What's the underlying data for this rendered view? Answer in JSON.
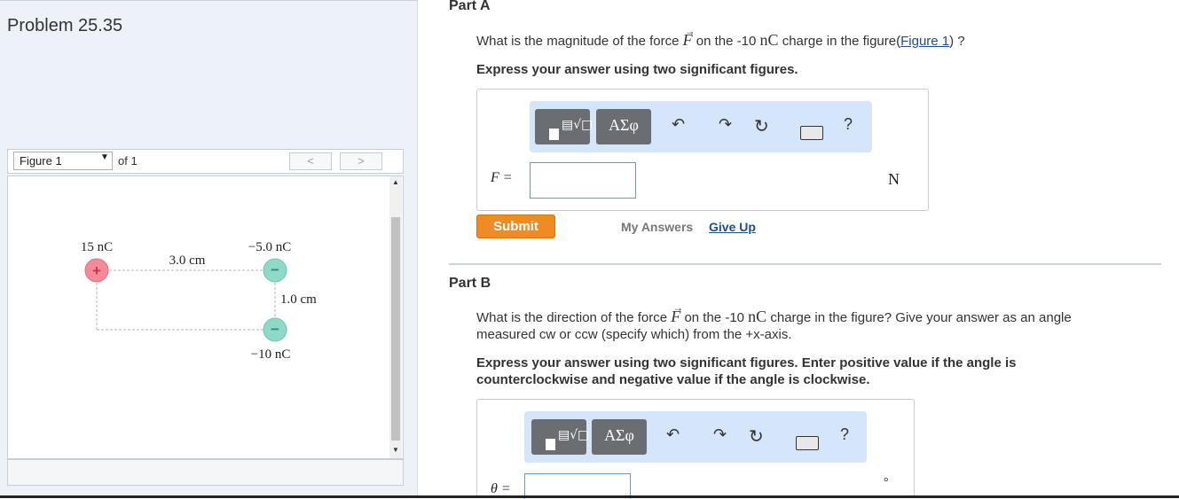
{
  "left": {
    "problem_title": "Problem 25.35",
    "figure_select": "Figure 1",
    "of_label": "of 1",
    "prev": "<",
    "next": ">"
  },
  "figure": {
    "q1": "15 nC",
    "q2": "−5.0 nC",
    "q3": "−10 nC",
    "d_horizontal": "3.0 cm",
    "d_vertical": "1.0 cm",
    "plus": "+",
    "minus": "−"
  },
  "part_a": {
    "label": "Part A",
    "q_before": "What is the magnitude of the force ",
    "q_vec": "F",
    "q_mid": " on the -10 ",
    "q_unit": "nC",
    "q_after": " charge in the figure(",
    "q_link": "Figure 1",
    "q_end": ") ?",
    "instruction": "Express your answer using two significant figures.",
    "input_label": "F =",
    "unit": "N",
    "submit": "Submit",
    "my_answers": "My Answers",
    "give_up": "Give Up"
  },
  "part_b": {
    "label": "Part B",
    "q_before": "What is the direction of the force ",
    "q_vec": "F",
    "q_mid": " on the -10 ",
    "q_unit": "nC",
    "q_after": " charge in the figure? Give your answer as an angle",
    "q_line2": "measured cw or ccw (specify which) from the +x-axis.",
    "instruction_1": "Express your answer using two significant figures. Enter positive value if the angle is",
    "instruction_2": "counterclockwise and negative value if the angle is clockwise.",
    "input_label": "θ =",
    "unit": "°"
  },
  "toolbar": {
    "greek": "ΑΣφ",
    "help": "?"
  },
  "icons": [
    "templates-icon",
    "greek-icon",
    "undo-icon",
    "redo-icon",
    "reset-icon",
    "keyboard-icon",
    "help-icon",
    "dropdown-caret-icon",
    "scroll-up-icon",
    "scroll-down-icon"
  ],
  "colors": {
    "submit": "#ef8a24",
    "toolbar": "#d5e6fb",
    "positive_charge": "#f28a9a",
    "negative_charge": "#8fd9c8",
    "link": "#1f4e8c"
  }
}
